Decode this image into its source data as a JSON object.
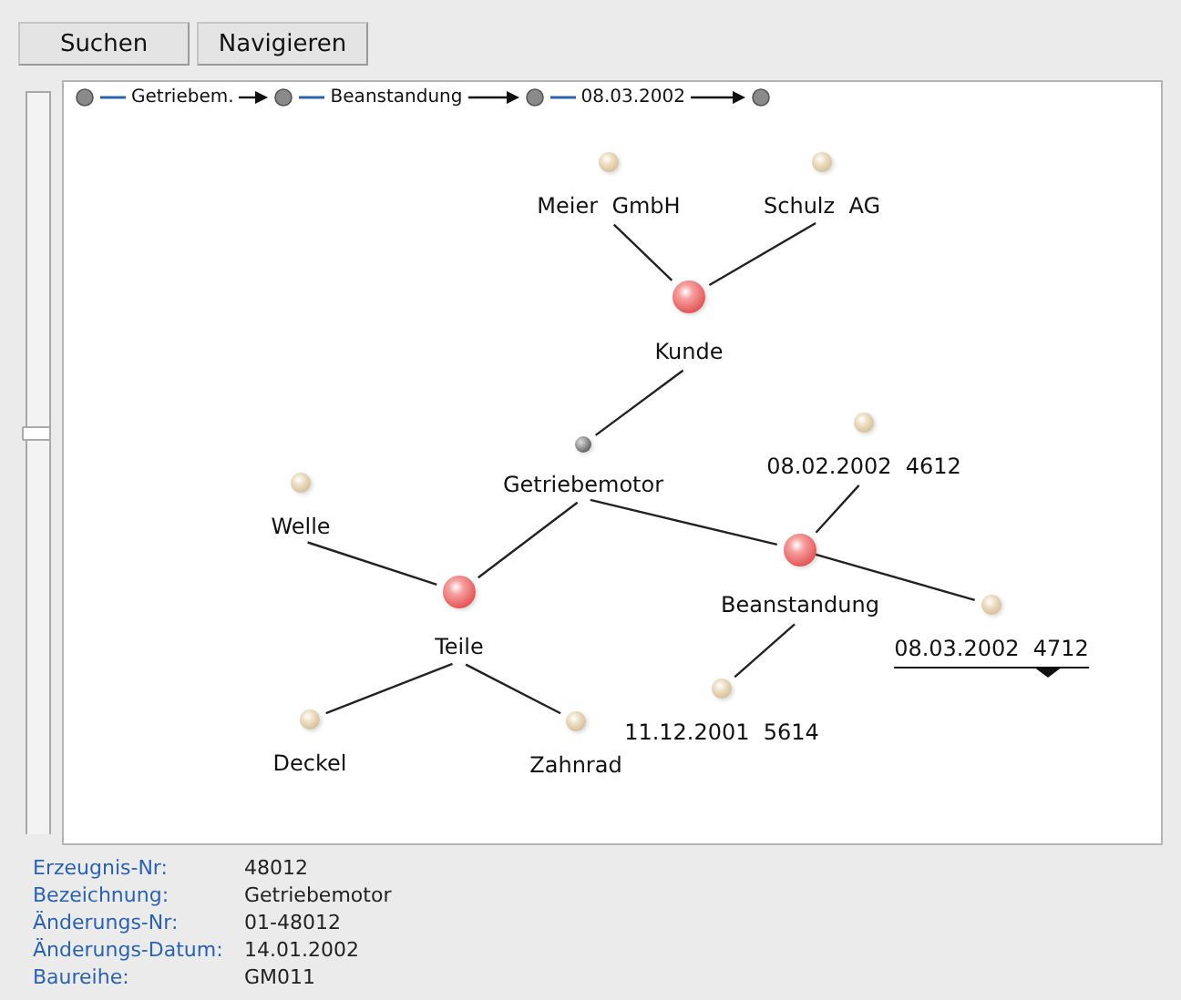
{
  "toolbar": {
    "buttons": [
      "Suchen",
      "Navigieren"
    ]
  },
  "breadcrumb": [
    "Getriebem.",
    "Beanstandung",
    "08.03.2002"
  ],
  "graph": {
    "label": "Getriebemotor",
    "kind": "root",
    "children": [
      {
        "label": "Kunde",
        "kind": "category",
        "children": [
          {
            "label": "Meier  GmbH",
            "kind": "leaf",
            "selected": false
          },
          {
            "label": "Schulz  AG",
            "kind": "leaf",
            "selected": false
          }
        ]
      },
      {
        "label": "Teile",
        "kind": "category",
        "children": [
          {
            "label": "Welle",
            "kind": "leaf",
            "selected": false
          },
          {
            "label": "Deckel",
            "kind": "leaf",
            "selected": false
          },
          {
            "label": "Zahnrad",
            "kind": "leaf",
            "selected": false
          }
        ]
      },
      {
        "label": "Beanstandung",
        "kind": "category",
        "children": [
          {
            "label": "08.02.2002  4612",
            "kind": "leaf",
            "selected": false
          },
          {
            "label": "11.12.2001  5614",
            "kind": "leaf",
            "selected": false
          },
          {
            "label": "08.03.2002  4712",
            "kind": "leaf",
            "selected": true
          }
        ]
      }
    ]
  },
  "details": [
    {
      "label": "Erzeugnis-Nr:",
      "value": "48012"
    },
    {
      "label": "Bezeichnung:",
      "value": "Getriebemotor"
    },
    {
      "label": "Änderungs-Nr:",
      "value": "01-48012"
    },
    {
      "label": "Änderungs-Datum:",
      "value": "14.01.2002"
    },
    {
      "label": "Baureihe:",
      "value": "GM011"
    }
  ]
}
